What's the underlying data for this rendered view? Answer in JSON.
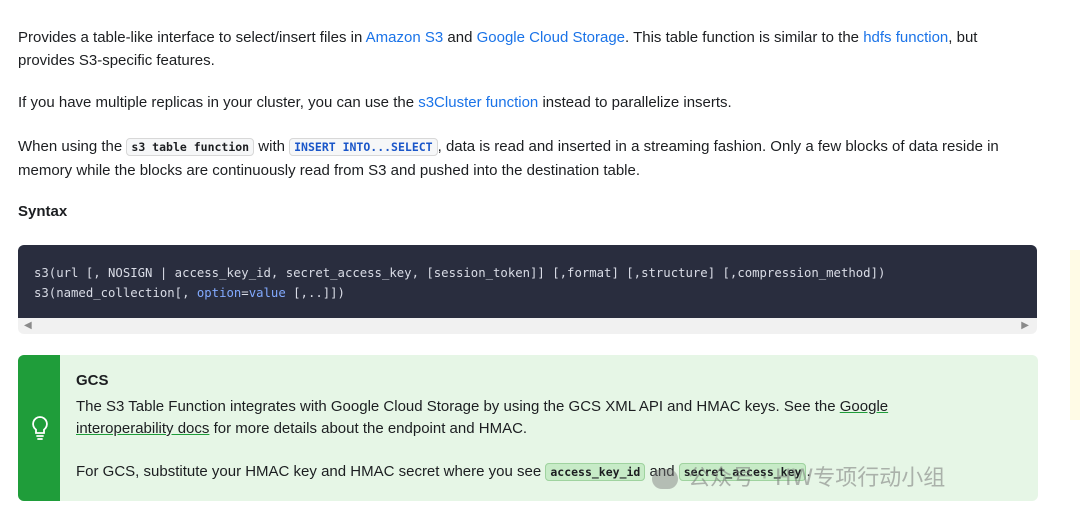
{
  "intro": {
    "p1_a": "Provides a table-like interface to select/insert files in ",
    "link_s3": "Amazon S3",
    "p1_b": " and ",
    "link_gcs": "Google Cloud Storage",
    "p1_c": ". This table function is similar to the ",
    "link_hdfs": "hdfs function",
    "p1_d": ", but provides S3-specific features.",
    "p2_a": "If you have multiple replicas in your cluster, you can use the ",
    "link_s3cluster": "s3Cluster function",
    "p2_b": " instead to parallelize inserts.",
    "p3_a": "When using the ",
    "code_s3": "s3 table function",
    "p3_b": " with ",
    "code_insert": "INSERT INTO...SELECT",
    "p3_c": ", data is read and inserted in a streaming fashion. Only a few blocks of data reside in memory while the blocks are continuously read from S3 and pushed into the destination table."
  },
  "syntax": {
    "heading": "Syntax",
    "line1": "s3(url [, NOSIGN | access_key_id, secret_access_key, [session_token]] [,format] [,structure] [,compression_method])",
    "line2_a": "s3(named_collection[, ",
    "line2_kw": "option",
    "line2_b": "=",
    "line2_val": "value",
    "line2_c": " [,..]])"
  },
  "admonition": {
    "title": "GCS",
    "body1_a": "The S3 Table Function integrates with Google Cloud Storage by using the GCS XML API and HMAC keys. See the ",
    "link": "Google interoperability docs",
    "body1_b": " for more details about the endpoint and HMAC.",
    "body2_a": "For GCS, substitute your HMAC key and HMAC secret where you see ",
    "code1": "access_key_id",
    "body2_b": " and ",
    "code2": "secret_access_key",
    "body2_c": "."
  },
  "watermark": "公众号 · HW专项行动小组",
  "icons": {
    "admonition": "lightbulb-icon",
    "scroll_left": "chevron-left-icon",
    "scroll_right": "chevron-right-icon"
  }
}
